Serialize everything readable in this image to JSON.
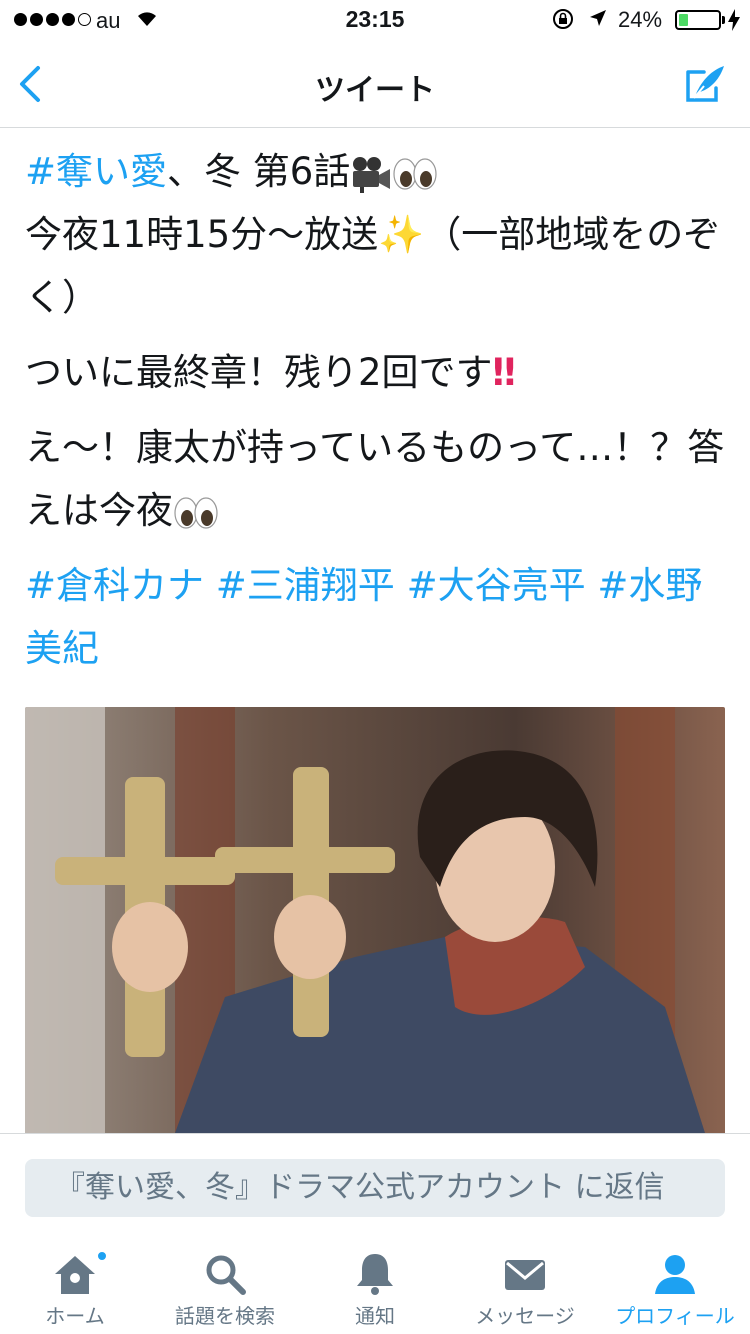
{
  "status_bar": {
    "carrier": "au",
    "time": "23:15",
    "battery_percent": "24%",
    "battery_level": 0.24
  },
  "nav": {
    "title": "ツイート"
  },
  "tweet": {
    "hashtag_title": "#奪い愛",
    "title_rest": "、冬 第6話",
    "line2": "今夜11時15分〜放送",
    "line2_rest": "（一部地域をのぞく）",
    "para2": "ついに最終章！残り2回です",
    "para3": "え〜！康太が持っているものって…！？答えは今夜",
    "hashtags": [
      "#倉科カナ",
      "#三浦翔平",
      "#大谷亮平",
      "#水野美紀"
    ]
  },
  "reply": {
    "placeholder": "『奪い愛、冬』ドラマ公式アカウント に返信"
  },
  "tabs": [
    {
      "label": "ホーム",
      "icon": "home-icon"
    },
    {
      "label": "話題を検索",
      "icon": "search-icon"
    },
    {
      "label": "通知",
      "icon": "bell-icon"
    },
    {
      "label": "メッセージ",
      "icon": "envelope-icon"
    },
    {
      "label": "プロフィール",
      "icon": "profile-icon"
    }
  ],
  "colors": {
    "accent": "#1da1f2",
    "text": "#14171a",
    "secondary": "#657786"
  }
}
